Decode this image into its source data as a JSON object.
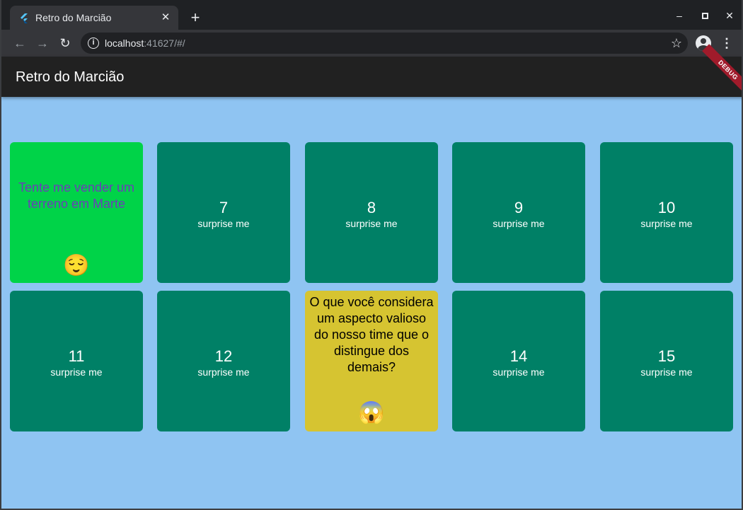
{
  "browser": {
    "tab_title": "Retro do Marcião",
    "tab_close": "✕",
    "new_tab": "+",
    "url_host": "localhost",
    "url_rest": ":41627/#/",
    "window_controls": {
      "minimize": "–",
      "maximize": "▫",
      "close": "✕"
    }
  },
  "app": {
    "title": "Retro do Marcião",
    "debug_label": "DEBUG"
  },
  "cards": [
    {
      "type": "question",
      "text": "Tente me vender um terreno em Marte",
      "emoji": "😌"
    },
    {
      "type": "hidden",
      "number": "7",
      "label": "surprise me"
    },
    {
      "type": "hidden",
      "number": "8",
      "label": "surprise me"
    },
    {
      "type": "hidden",
      "number": "9",
      "label": "surprise me"
    },
    {
      "type": "hidden",
      "number": "10",
      "label": "surprise me"
    },
    {
      "type": "hidden",
      "number": "11",
      "label": "surprise me"
    },
    {
      "type": "hidden",
      "number": "12",
      "label": "surprise me"
    },
    {
      "type": "question",
      "text": "O que você considera um aspecto valioso do nosso time que o distingue dos demais?",
      "emoji": "😱"
    },
    {
      "type": "hidden",
      "number": "14",
      "label": "surprise me"
    },
    {
      "type": "hidden",
      "number": "15",
      "label": "surprise me"
    }
  ],
  "colors": {
    "background": "#8fc4f2",
    "hidden_card": "#008066",
    "revealed_card_1": "#00d348",
    "revealed_card_2": "#d6c431",
    "appbar": "#212121"
  }
}
